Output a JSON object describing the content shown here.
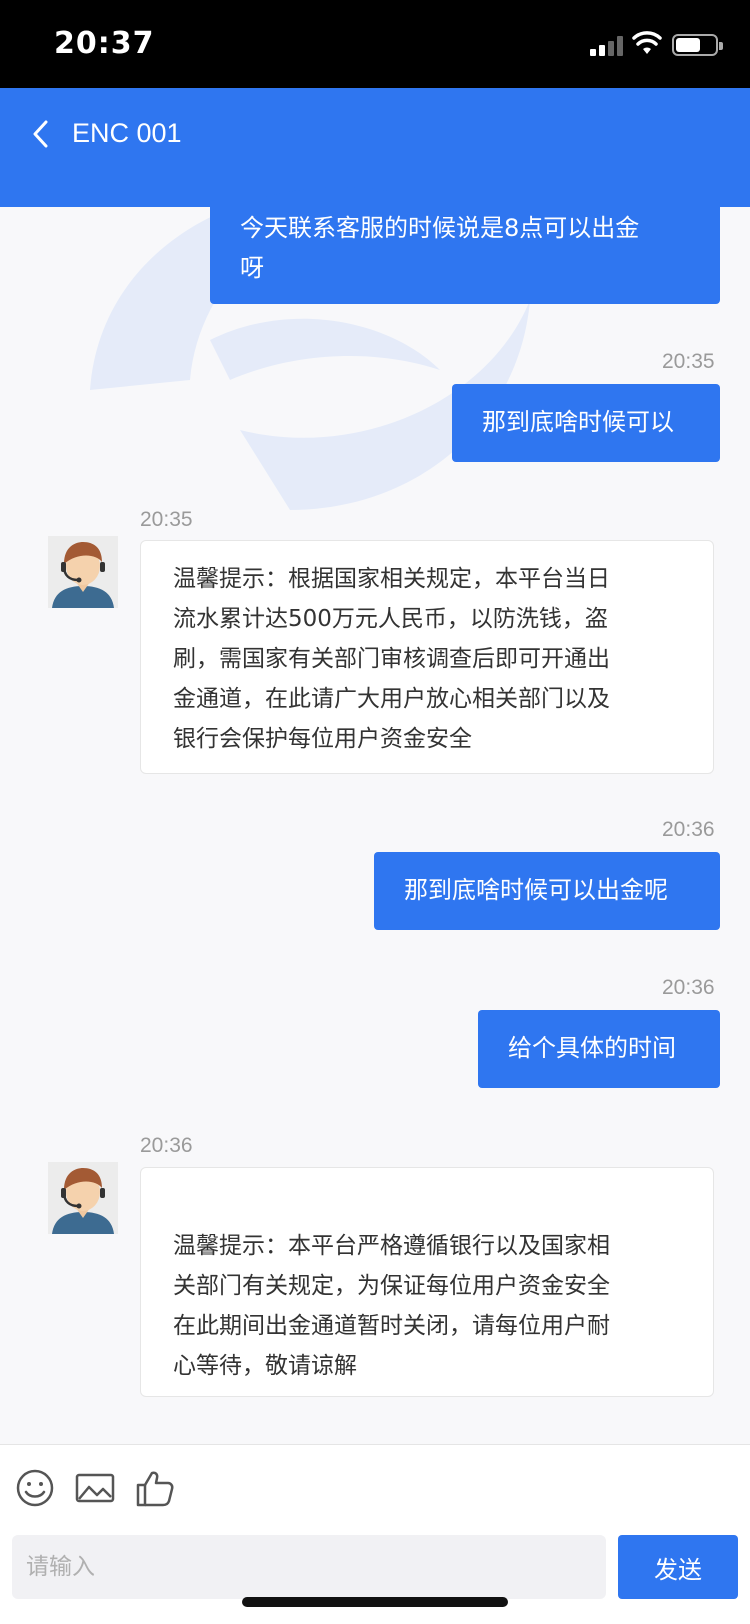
{
  "status_bar": {
    "time": "20:37"
  },
  "header": {
    "title": "ENC 001",
    "back_icon": "chevron-left-icon"
  },
  "messages": [
    {
      "side": "right",
      "text": "今天联系客服的时候说是8点可以出金呀",
      "lines": [
        "今天联系客服的时候说是8点可以出金",
        "呀"
      ]
    },
    {
      "side": "right",
      "time": "20:35",
      "text": "那到底啥时候可以"
    },
    {
      "side": "left",
      "time": "20:35",
      "text": "温馨提示：根据国家相关规定，本平台当日流水累计达500万元人民币，以防洗钱，盗刷，需国家有关部门审核调查后即可开通出金通道，在此请广大用户放心相关部门以及银行会保护每位用户资金安全",
      "lines": [
        "温馨提示：根据国家相关规定，本平台当日",
        "流水累计达500万元人民币，以防洗钱，盗",
        "刷，需国家有关部门审核调查后即可开通出",
        "金通道，在此请广大用户放心相关部门以及",
        "银行会保护每位用户资金安全"
      ]
    },
    {
      "side": "right",
      "time": "20:36",
      "text": "那到底啥时候可以出金呢"
    },
    {
      "side": "right",
      "time": "20:36",
      "text": "给个具体的时间"
    },
    {
      "side": "left",
      "time": "20:36",
      "text": "温馨提示：本平台严格遵循银行以及国家相关部门有关规定，为保证每位用户资金安全在此期间出金通道暂时关闭，请每位用户耐心等待，敬请谅解",
      "lines": [
        "温馨提示：本平台严格遵循银行以及国家相",
        "关部门有关规定，为保证每位用户资金安全",
        "在此期间出金通道暂时关闭，请每位用户耐",
        "心等待，敬请谅解"
      ]
    }
  ],
  "footer": {
    "tools": [
      "smiley-icon",
      "image-icon",
      "thumbs-up-icon"
    ],
    "input_placeholder": "请输入",
    "input_value": "",
    "send_label": "发送"
  },
  "colors": {
    "accent": "#2f76f0",
    "status_bar": "#000000",
    "background": "#f8f8fa"
  }
}
